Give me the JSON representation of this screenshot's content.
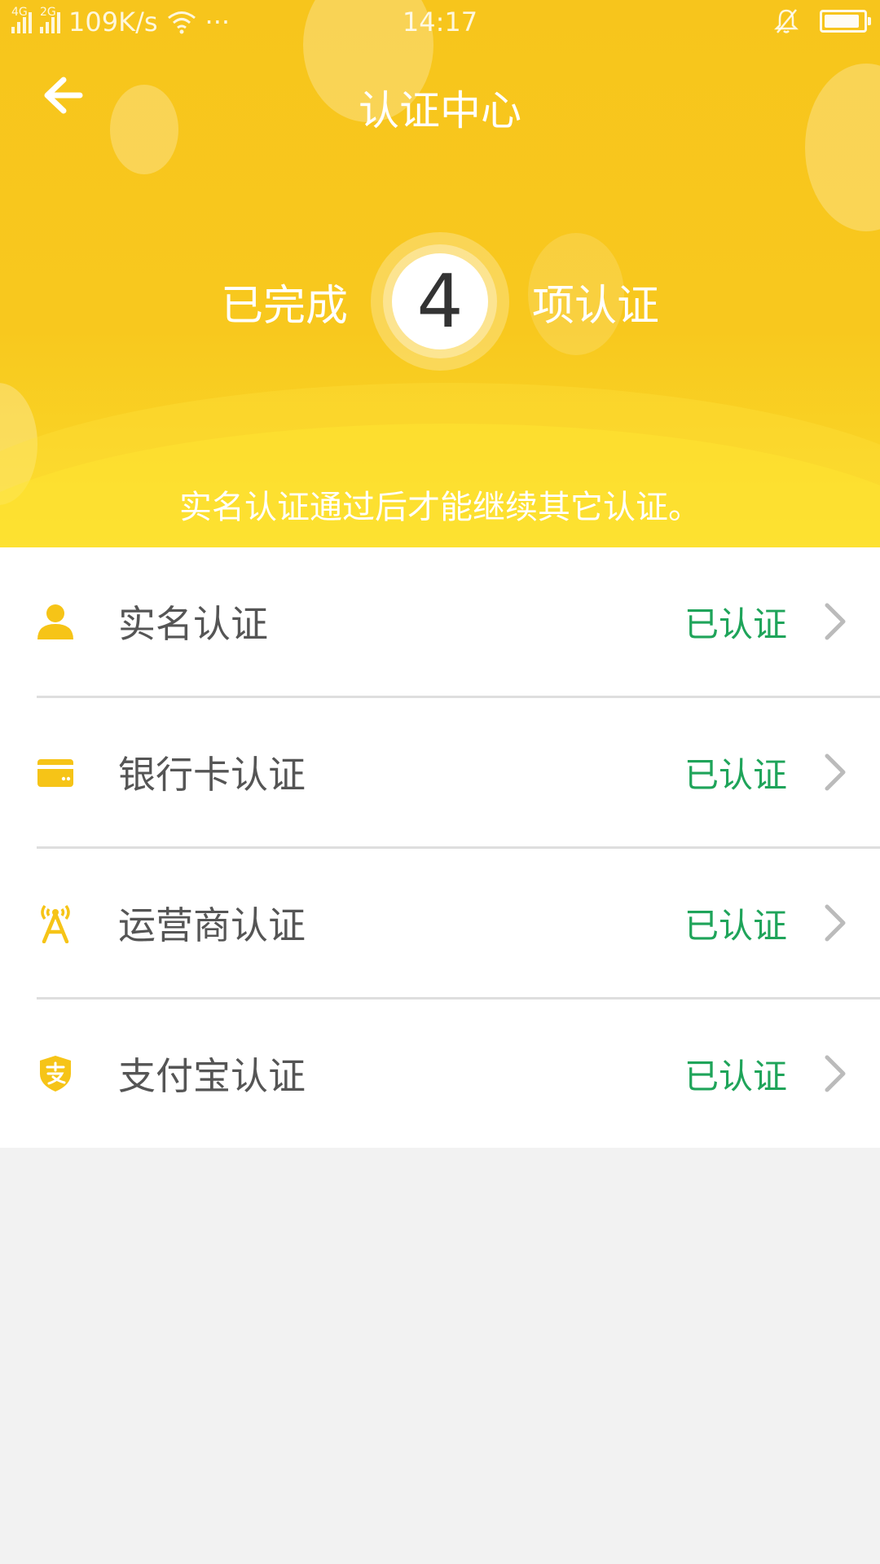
{
  "statusbar": {
    "net1": "4G",
    "net2": "2G",
    "speed": "109K/s",
    "dots": "···",
    "time": "14:17"
  },
  "header": {
    "title": "认证中心",
    "completed_prefix": "已完成",
    "completed_count": "4",
    "completed_suffix": "项认证",
    "notice": "实名认证通过后才能继续其它认证。"
  },
  "colors": {
    "brand_yellow": "#f7c51c",
    "verified_green": "#1fa45a",
    "icon_yellow": "#f6c417"
  },
  "items": [
    {
      "label": "实名认证",
      "status": "已认证",
      "icon": "person-icon"
    },
    {
      "label": "银行卡认证",
      "status": "已认证",
      "icon": "bank-card-icon"
    },
    {
      "label": "运营商认证",
      "status": "已认证",
      "icon": "signal-tower-icon"
    },
    {
      "label": "支付宝认证",
      "status": "已认证",
      "icon": "alipay-shield-icon"
    }
  ]
}
